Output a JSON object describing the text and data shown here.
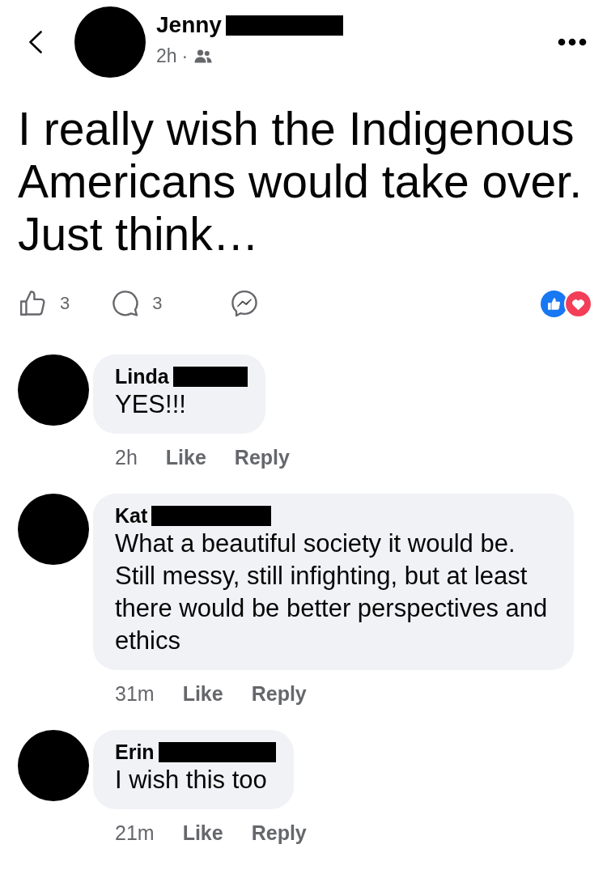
{
  "post": {
    "author": {
      "name": "Jenny",
      "redacted": true
    },
    "time": "2h",
    "separator": "·",
    "text": "I really wish the Indigenous Americans would take over. Just think…",
    "like_count": "3",
    "comment_count": "3"
  },
  "comments": [
    {
      "author": {
        "name": "Linda",
        "redacted": true
      },
      "text": "YES!!!",
      "time": "2h",
      "like": "Like",
      "reply": "Reply"
    },
    {
      "author": {
        "name": "Kat",
        "redacted": true
      },
      "text": "What a beautiful society it would be. Still messy, still infighting, but at least there would be better perspectives and ethics",
      "time": "31m",
      "like": "Like",
      "reply": "Reply"
    },
    {
      "author": {
        "name": "Erin",
        "redacted": true
      },
      "text": "I wish this too",
      "time": "21m",
      "like": "Like",
      "reply": "Reply"
    }
  ]
}
